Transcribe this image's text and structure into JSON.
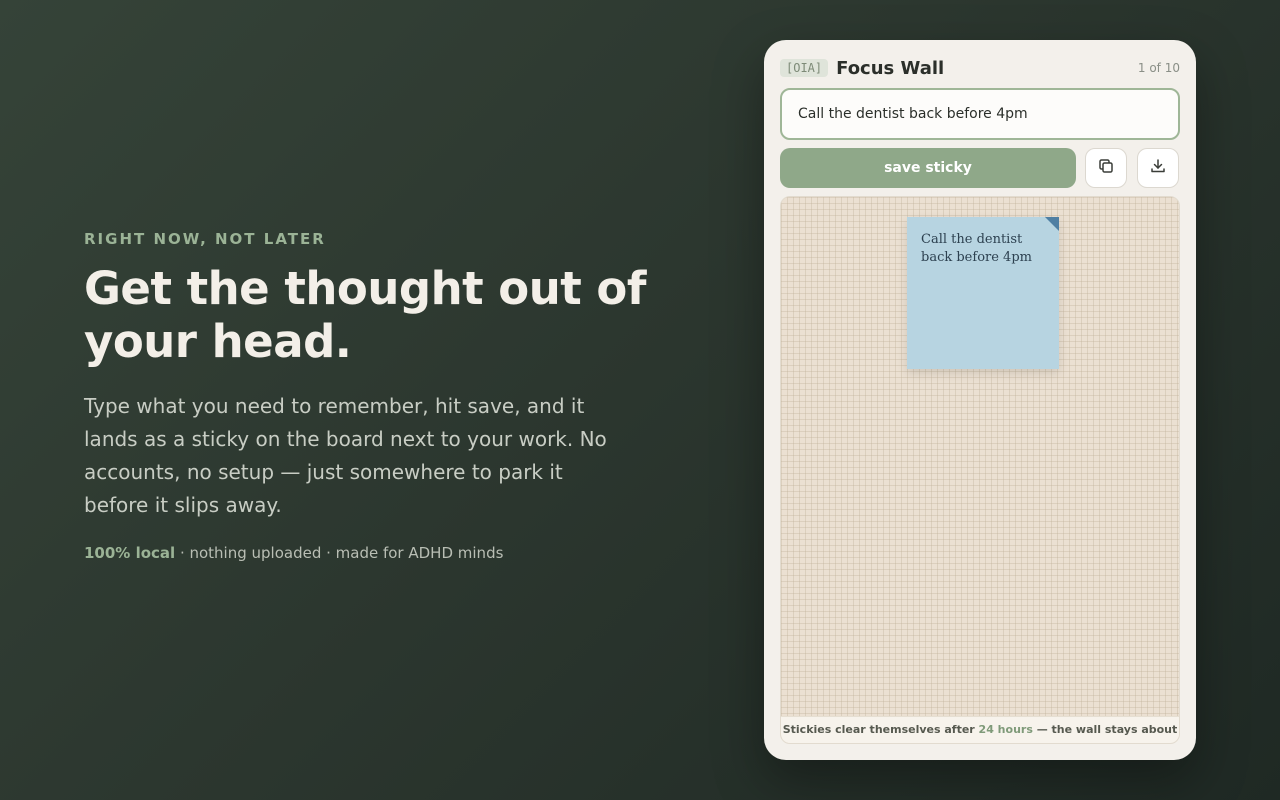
{
  "hero": {
    "eyebrow": "RIGHT NOW, NOT LATER",
    "headline": "Get the thought out of your head.",
    "body": "Type what you need to remember, hit save, and it lands as a sticky on the board next to your work. No accounts, no setup — just somewhere to park it before it slips away.",
    "meta_emphasis": "100% local",
    "meta_rest": " · nothing uploaded · made for ADHD minds"
  },
  "panel": {
    "badge": "[OIA]",
    "title": "Focus Wall",
    "counter": "1 of 10",
    "input_value": "Call the dentist back before 4pm",
    "save_label": "save sticky",
    "copy_icon": "copy-icon",
    "download_icon": "download-icon",
    "sticky": {
      "text": "Call the dentist back before 4pm",
      "color": "#b7d4e1"
    },
    "footer": {
      "prefix": "Stickies clear themselves after ",
      "highlight": "24 hours",
      "suffix": " — the wall stays about now."
    }
  },
  "colors": {
    "accent": "#8fa889",
    "background": "#2c372f",
    "sticky_blue": "#b7d4e1"
  }
}
